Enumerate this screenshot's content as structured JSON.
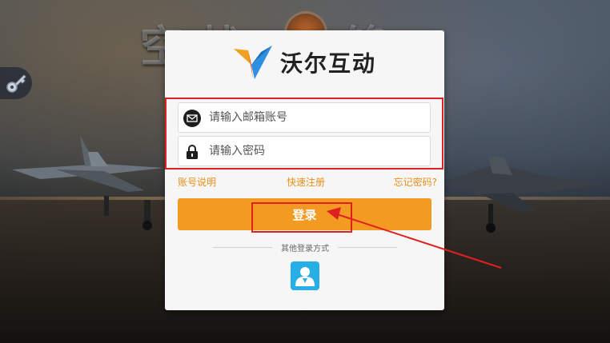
{
  "background": {
    "title_left": "空战",
    "title_right": "争锋"
  },
  "sidebar": {
    "key_icon": "key-icon"
  },
  "dialog": {
    "brand": "沃尔互动",
    "email_placeholder": "请输入邮箱账号",
    "password_placeholder": "请输入密码",
    "links": {
      "account_help": "账号说明",
      "quick_register": "快速注册",
      "forgot_password": "忘记密码?"
    },
    "login_label": "登录",
    "other_methods": "其他登录方式",
    "guest_icon": "user-icon"
  },
  "colors": {
    "accent": "#f39a23",
    "link": "#e8901a",
    "highlight": "#e02020",
    "guest": "#28aee6"
  }
}
